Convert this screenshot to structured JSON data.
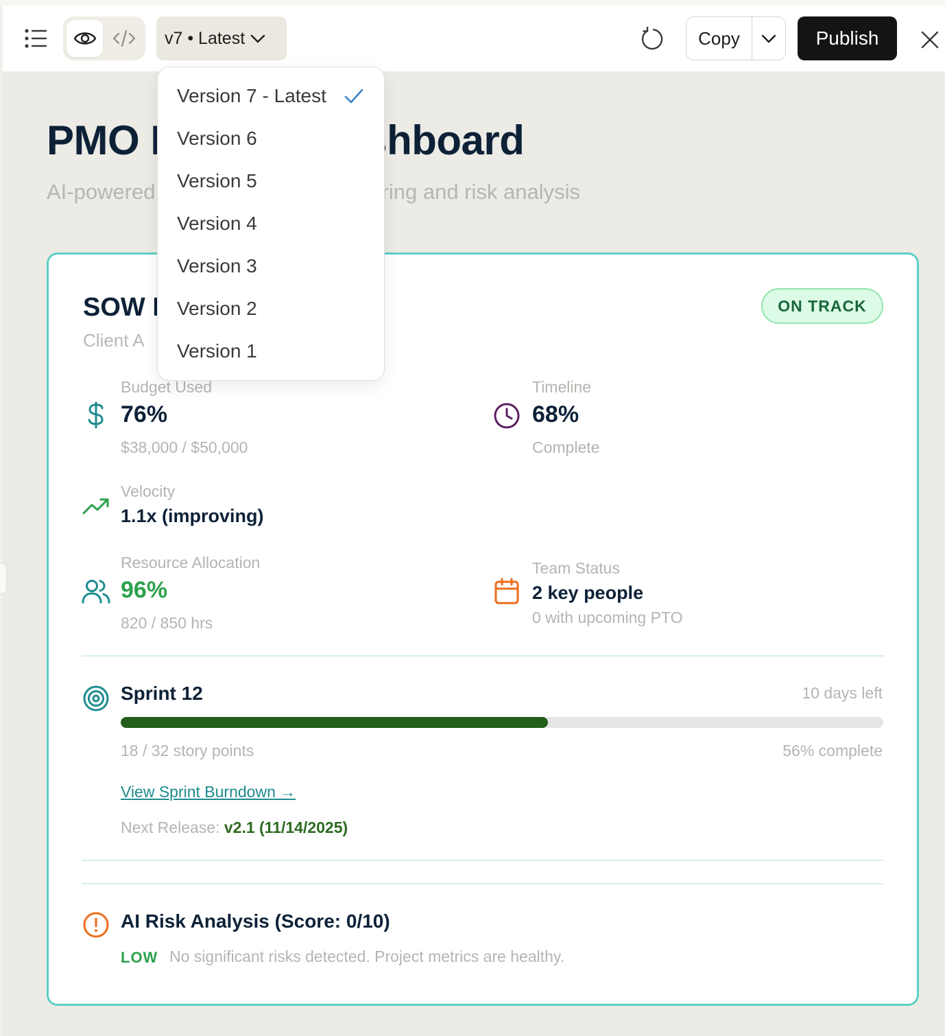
{
  "toolbar": {
    "version_label": "v7 • Latest",
    "copy_label": "Copy",
    "publish_label": "Publish"
  },
  "version_menu": {
    "items": [
      {
        "label": "Version 7 - Latest",
        "selected": true
      },
      {
        "label": "Version 6",
        "selected": false
      },
      {
        "label": "Version 5",
        "selected": false
      },
      {
        "label": "Version 4",
        "selected": false
      },
      {
        "label": "Version 3",
        "selected": false
      },
      {
        "label": "Version 2",
        "selected": false
      },
      {
        "label": "Version 1",
        "selected": false
      }
    ]
  },
  "page": {
    "title": "PMO Dashboard",
    "title_visible_left": "PMO I",
    "title_visible_right": "Dashboard",
    "subtitle_visible_left": "AI-powered",
    "subtitle_visible_right": "ring and risk analysis"
  },
  "card": {
    "title_visible": "SOW I",
    "client_visible": "Client A",
    "status": "ON TRACK",
    "budget": {
      "label": "Budget Used",
      "value": "76%",
      "sub": "$38,000 / $50,000"
    },
    "timeline": {
      "label": "Timeline",
      "value": "68%",
      "sub": "Complete"
    },
    "velocity": {
      "label": "Velocity",
      "value": "1.1x (improving)"
    },
    "resources": {
      "label": "Resource Allocation",
      "value": "96%",
      "sub": "820 / 850 hrs"
    },
    "team": {
      "label": "Team Status",
      "value": "2 key people",
      "sub": "0 with upcoming PTO"
    },
    "sprint": {
      "title": "Sprint 12",
      "days_left": "10 days left",
      "progress_fraction": 0.56,
      "points": "18 / 32 story points",
      "percent": "56% complete",
      "burndown_link": "View Sprint Burndown →",
      "release_label": "Next Release:",
      "release_value": "v2.1 (11/14/2025)"
    },
    "risk": {
      "title": "AI Risk Analysis (Score: 0/10)",
      "level": "LOW",
      "text": "No significant risks detected. Project metrics are healthy."
    }
  },
  "colors": {
    "accent_teal": "#5dd0c6",
    "status_green": "#2da14e",
    "progress_fill": "#235d1a",
    "publish_bg": "#141414"
  },
  "icons": {
    "menu": "list-icon",
    "preview": "eye-icon",
    "code": "code-icon",
    "version_caret": "chevron-down-icon",
    "refresh": "refresh-icon",
    "close": "close-icon",
    "budget": "dollar-icon",
    "timeline": "clock-icon",
    "velocity": "trending-up-icon",
    "resources": "users-icon",
    "team": "calendar-icon",
    "sprint": "target-icon",
    "risk": "alert-circle-icon",
    "selected": "check-icon"
  }
}
